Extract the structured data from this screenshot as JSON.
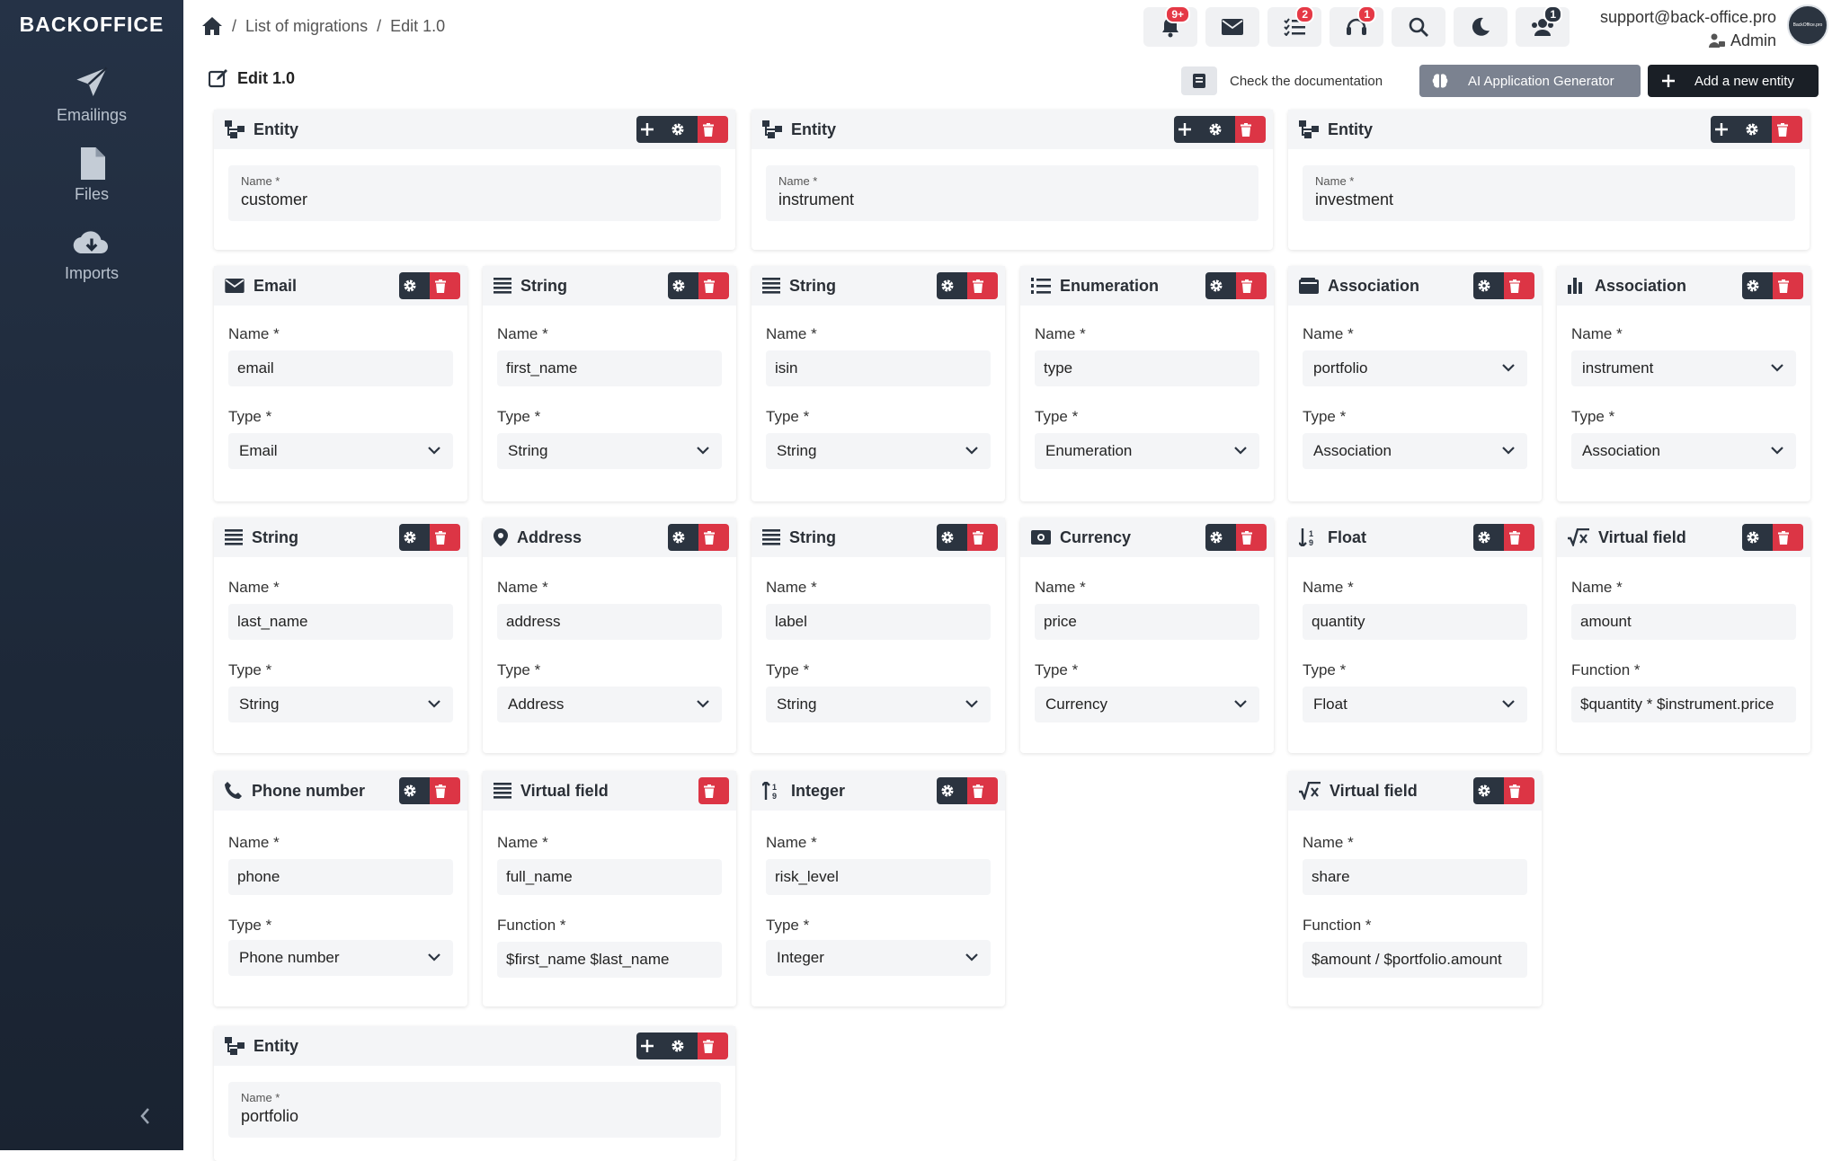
{
  "sidebar": {
    "brand": "BACKOFFICE",
    "items": [
      {
        "label": "Emailings",
        "icon": "paper-plane-icon"
      },
      {
        "label": "Files",
        "icon": "file-icon"
      },
      {
        "label": "Imports",
        "icon": "cloud-download-icon"
      }
    ]
  },
  "breadcrumb": {
    "home_icon": "home-icon",
    "items": [
      "List of migrations",
      "Edit 1.0"
    ],
    "sep": "/"
  },
  "topbar": {
    "badges": {
      "notifications": "9+",
      "tasks": "2",
      "support": "1",
      "users": "1"
    },
    "user_email": "support@back-office.pro",
    "user_role": "Admin",
    "avatar_text": "BackOffice.pro"
  },
  "page": {
    "title": "Edit 1.0",
    "doc_button": "Check the documentation",
    "ai_button": "AI Application Generator",
    "add_entity_button": "Add a new entity"
  },
  "entities": [
    {
      "title": "Entity",
      "name_label": "Name *",
      "name": "customer"
    },
    {
      "title": "Entity",
      "name_label": "Name *",
      "name": "instrument"
    },
    {
      "title": "Entity",
      "name_label": "Name *",
      "name": "investment"
    },
    {
      "title": "Entity",
      "name_label": "Name *",
      "name": "portfolio"
    }
  ],
  "fields": [
    {
      "title": "Email",
      "name_label": "Name *",
      "name": "email",
      "second_label": "Type *",
      "second": "Email"
    },
    {
      "title": "String",
      "name_label": "Name *",
      "name": "first_name",
      "second_label": "Type *",
      "second": "String"
    },
    {
      "title": "String",
      "name_label": "Name *",
      "name": "isin",
      "second_label": "Type *",
      "second": "String"
    },
    {
      "title": "Enumeration",
      "name_label": "Name *",
      "name": "type",
      "second_label": "Type *",
      "second": "Enumeration"
    },
    {
      "title": "Association",
      "name_label": "Name *",
      "name": "portfolio",
      "second_label": "Type *",
      "second": "Association"
    },
    {
      "title": "Association",
      "name_label": "Name *",
      "name": "instrument",
      "second_label": "Type *",
      "second": "Association"
    },
    {
      "title": "String",
      "name_label": "Name *",
      "name": "last_name",
      "second_label": "Type *",
      "second": "String"
    },
    {
      "title": "Address",
      "name_label": "Name *",
      "name": "address",
      "second_label": "Type *",
      "second": "Address"
    },
    {
      "title": "String",
      "name_label": "Name *",
      "name": "label",
      "second_label": "Type *",
      "second": "String"
    },
    {
      "title": "Currency",
      "name_label": "Name *",
      "name": "price",
      "second_label": "Type *",
      "second": "Currency"
    },
    {
      "title": "Float",
      "name_label": "Name *",
      "name": "quantity",
      "second_label": "Type *",
      "second": "Float"
    },
    {
      "title": "Virtual field",
      "name_label": "Name *",
      "name": "amount",
      "second_label": "Function *",
      "second": "$quantity * $instrument.price"
    },
    {
      "title": "Phone number",
      "name_label": "Name *",
      "name": "phone",
      "second_label": "Type *",
      "second": "Phone number"
    },
    {
      "title": "Virtual field",
      "name_label": "Name *",
      "name": "full_name",
      "second_label": "Function *",
      "second": "$first_name $last_name"
    },
    {
      "title": "Integer",
      "name_label": "Name *",
      "name": "risk_level",
      "second_label": "Type *",
      "second": "Integer"
    },
    {
      "title": "Virtual field",
      "name_label": "Name *",
      "name": "share",
      "second_label": "Function *",
      "second": "$amount / $portfolio.amount"
    }
  ],
  "colors": {
    "dark": "#2b3440",
    "danger": "#dc3545",
    "sidebar": "#1f2a3a",
    "gray_button": "#7b8290"
  }
}
